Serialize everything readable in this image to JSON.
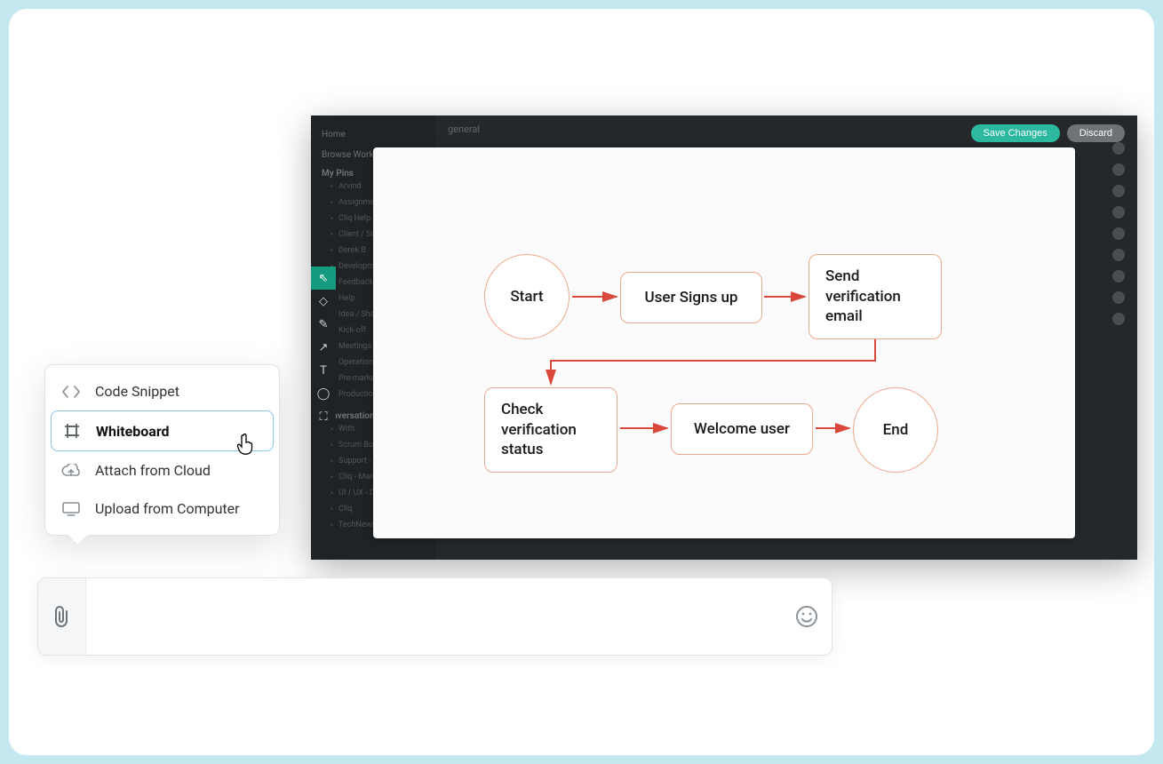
{
  "app": {
    "nav": {
      "home": "Home",
      "browse": "Browse Workspace"
    },
    "sections": {
      "pins_title": "My Pins",
      "conversations_title": "Conversations"
    },
    "pins": [
      "Arvind",
      "Assignments",
      "Cliq Help Portal",
      "Client / Stakeholders",
      "Derek B",
      "Development",
      "Feedback",
      "Help",
      "Idea / Sharing",
      "Kick-off",
      "Meetings",
      "Operations",
      "Pre-market analysis",
      "Production"
    ],
    "conversations": [
      "With",
      "Scrum Bot",
      "Support - Europe",
      "Cliq - Marketing",
      "UI / UX - Discussion",
      "Cliq",
      "TechNews"
    ],
    "buttons": {
      "save": "Save Changes",
      "discard": "Discard"
    },
    "main_title": "general"
  },
  "tools": [
    {
      "name": "select-tool-icon",
      "glyph": "⇖",
      "active": true
    },
    {
      "name": "shape-tool-icon",
      "glyph": "◇",
      "active": false
    },
    {
      "name": "pen-tool-icon",
      "glyph": "✎",
      "active": false
    },
    {
      "name": "arrow-tool-icon",
      "glyph": "↗",
      "active": false
    },
    {
      "name": "text-tool-icon",
      "glyph": "T",
      "active": false
    },
    {
      "name": "chat-tool-icon",
      "glyph": "◯",
      "active": false
    },
    {
      "name": "crop-tool-icon",
      "glyph": "⛶",
      "active": false
    }
  ],
  "flow": {
    "start": "Start",
    "signup": "User Signs up",
    "send_email": "Send verification email",
    "check_status": "Check verification status",
    "welcome": "Welcome user",
    "end": "End"
  },
  "attach_menu": {
    "code": "Code Snippet",
    "whiteboard": "Whiteboard",
    "cloud": "Attach from Cloud",
    "computer": "Upload from Computer"
  },
  "message": {
    "placeholder": ""
  },
  "colors": {
    "accent_teal": "#2cb9a0",
    "node_border": "#f0a88e",
    "arrow": "#d9483b"
  }
}
